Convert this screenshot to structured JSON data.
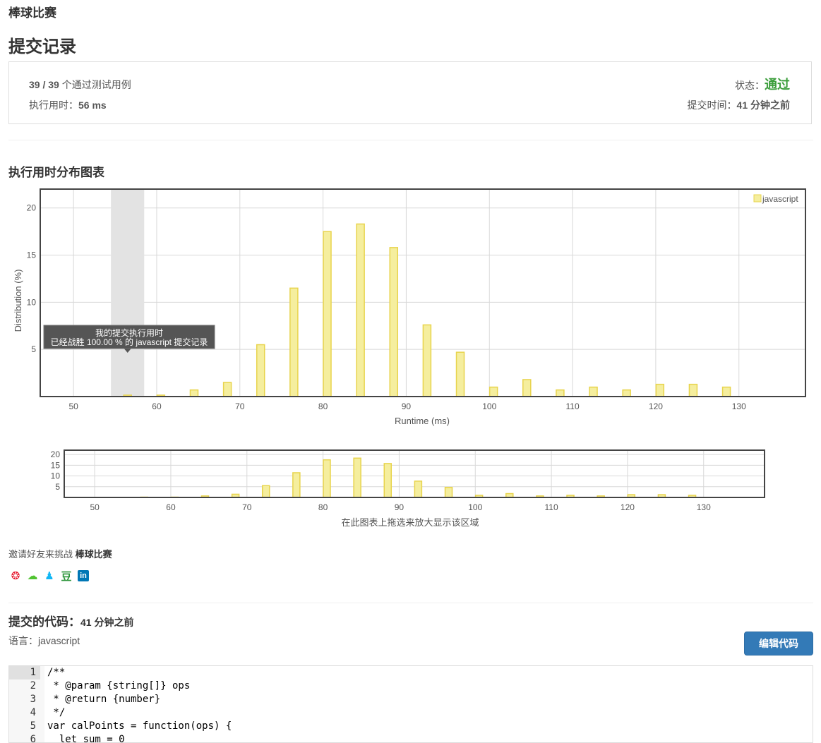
{
  "problem_title": "棒球比赛",
  "page_title": "提交记录",
  "summary": {
    "passed": "39 / 39",
    "passed_suffix": " 个通过测试用例",
    "runtime_label": "执行用时：",
    "runtime_value": "56 ms",
    "status_label": "状态：",
    "status_value": "通过",
    "submit_time_label": "提交时间：",
    "submit_time_value": "41 分钟之前"
  },
  "chart_section_title": "执行用时分布图表",
  "chart_data": {
    "type": "bar",
    "xlabel": "Runtime (ms)",
    "ylabel": "Distribution (%)",
    "xlim": [
      46,
      138
    ],
    "ylim": [
      0,
      22
    ],
    "x_ticks": [
      50,
      60,
      70,
      80,
      90,
      100,
      110,
      120,
      130
    ],
    "y_ticks": [
      5,
      10,
      15,
      20
    ],
    "grid": true,
    "legend": "top-right",
    "series": [
      {
        "name": "javascript",
        "color": "#f5ee9e",
        "stroke": "#e8d44d",
        "x": [
          56.5,
          60.5,
          64.5,
          68.5,
          72.5,
          76.5,
          80.5,
          84.5,
          88.5,
          92.5,
          96.5,
          100.5,
          104.5,
          108.5,
          112.5,
          116.5,
          120.5,
          124.5,
          128.5
        ],
        "values": [
          0.15,
          0.15,
          0.7,
          1.5,
          5.5,
          11.5,
          17.5,
          18.3,
          15.8,
          7.6,
          4.7,
          1.0,
          1.8,
          0.7,
          1.0,
          0.7,
          1.3,
          1.3,
          1.0
        ]
      }
    ],
    "highlight_range": [
      54.5,
      58.5
    ],
    "tooltip": {
      "line1": "我的提交执行用时",
      "line2": "已经战胜 100.00 % 的 javascript 提交记录"
    },
    "navigator": {
      "ylim": [
        0,
        22
      ],
      "y_ticks": [
        5,
        10,
        15,
        20
      ],
      "hint": "在此图表上拖选来放大显示该区域"
    }
  },
  "invite": {
    "prefix": "邀请好友来挑战 ",
    "problem": "棒球比赛"
  },
  "share_icons": [
    {
      "name": "weibo-icon",
      "glyph": "❂",
      "color": "#e6162d"
    },
    {
      "name": "wechat-icon",
      "glyph": "☁",
      "color": "#51c332"
    },
    {
      "name": "qq-icon",
      "glyph": "♟",
      "color": "#12b7f5"
    },
    {
      "name": "douban-icon",
      "glyph": "豆",
      "color": "#2e963d"
    },
    {
      "name": "linkedin-icon",
      "glyph": "in",
      "color": "#0077b5"
    }
  ],
  "code_section": {
    "title": "提交的代码：",
    "time": "41 分钟之前",
    "language_label": "语言：",
    "language": "javascript",
    "edit_button": "编辑代码"
  },
  "code_lines": [
    {
      "n": "1",
      "text": "/**"
    },
    {
      "n": "2",
      "text": " * @param {string[]} ops"
    },
    {
      "n": "3",
      "text": " * @return {number}"
    },
    {
      "n": "4",
      "text": " */"
    },
    {
      "n": "5",
      "text": "var calPoints = function(ops) {"
    },
    {
      "n": "6",
      "text": "  let sum = 0"
    }
  ]
}
